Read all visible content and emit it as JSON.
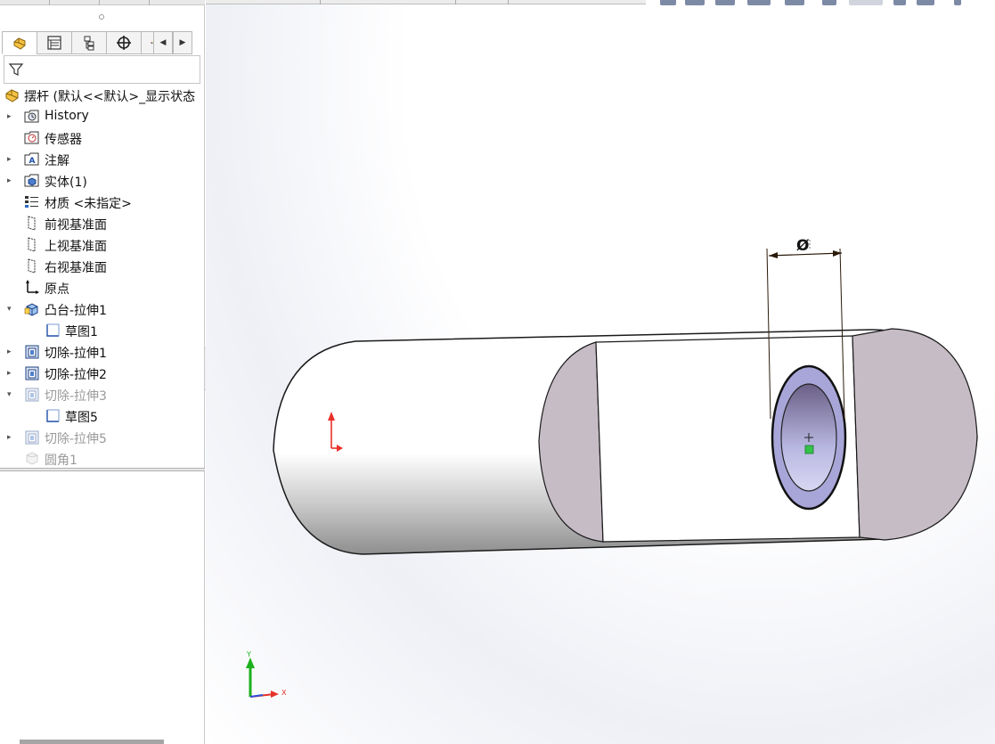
{
  "feature_tree": {
    "root": {
      "label": "摆杆  (默认<<默认>_显示状态",
      "icon": "part-icon"
    },
    "items": [
      {
        "label": "History",
        "icon": "history-folder-icon",
        "expander": true,
        "dim": false,
        "indent": 0
      },
      {
        "label": "传感器",
        "icon": "sensor-folder-icon",
        "expander": false,
        "dim": false,
        "indent": 0
      },
      {
        "label": "注解",
        "icon": "annotation-folder-icon",
        "expander": true,
        "dim": false,
        "indent": 0
      },
      {
        "label": "实体(1)",
        "icon": "solid-bodies-folder-icon",
        "expander": true,
        "dim": false,
        "indent": 0
      },
      {
        "label": "材质 <未指定>",
        "icon": "material-icon",
        "expander": false,
        "dim": false,
        "indent": 0
      },
      {
        "label": "前视基准面",
        "icon": "plane-icon",
        "expander": false,
        "dim": false,
        "indent": 0
      },
      {
        "label": "上视基准面",
        "icon": "plane-icon",
        "expander": false,
        "dim": false,
        "indent": 0
      },
      {
        "label": "右视基准面",
        "icon": "plane-icon",
        "expander": false,
        "dim": false,
        "indent": 0
      },
      {
        "label": "原点",
        "icon": "origin-icon",
        "expander": false,
        "dim": false,
        "indent": 0
      },
      {
        "label": "凸台-拉伸1",
        "icon": "boss-extrude-icon",
        "expander": true,
        "expanded": true,
        "dim": false,
        "indent": 0
      },
      {
        "label": "草图1",
        "icon": "sketch-icon",
        "expander": false,
        "dim": false,
        "indent": 1
      },
      {
        "label": "切除-拉伸1",
        "icon": "cut-extrude-icon",
        "expander": true,
        "dim": false,
        "indent": 0
      },
      {
        "label": "切除-拉伸2",
        "icon": "cut-extrude-icon",
        "expander": true,
        "dim": false,
        "indent": 0
      },
      {
        "label": "切除-拉伸3",
        "icon": "cut-extrude-icon",
        "expander": true,
        "expanded": true,
        "dim": true,
        "indent": 0
      },
      {
        "label": "草图5",
        "icon": "sketch-icon",
        "expander": false,
        "dim": false,
        "indent": 1
      },
      {
        "label": "切除-拉伸5",
        "icon": "cut-extrude-icon",
        "expander": true,
        "dim": true,
        "indent": 0
      },
      {
        "label": "圆角1",
        "icon": "fillet-icon",
        "expander": false,
        "dim": true,
        "indent": 0
      }
    ]
  },
  "tabs": [
    {
      "name": "feature-manager-tab",
      "icon": "part-icon",
      "active": true
    },
    {
      "name": "property-manager-tab",
      "icon": "property-list-icon",
      "active": false
    },
    {
      "name": "configuration-manager-tab",
      "icon": "configuration-icon",
      "active": false
    },
    {
      "name": "dimxpert-manager-tab",
      "icon": "crosshair-icon",
      "active": false
    },
    {
      "name": "display-manager-tab",
      "icon": "color-wheel-icon",
      "active": false
    }
  ],
  "viewport": {
    "dimension_label": "Ø",
    "triad_labels": {
      "y": "Y",
      "x": "X"
    },
    "colors": {
      "face_shade": "#c6bcc5",
      "hole_fill": "#a8a6d8",
      "origin_marker": "#e8312a",
      "triad_y": "#1db01d",
      "triad_x": "#e8312a"
    }
  }
}
